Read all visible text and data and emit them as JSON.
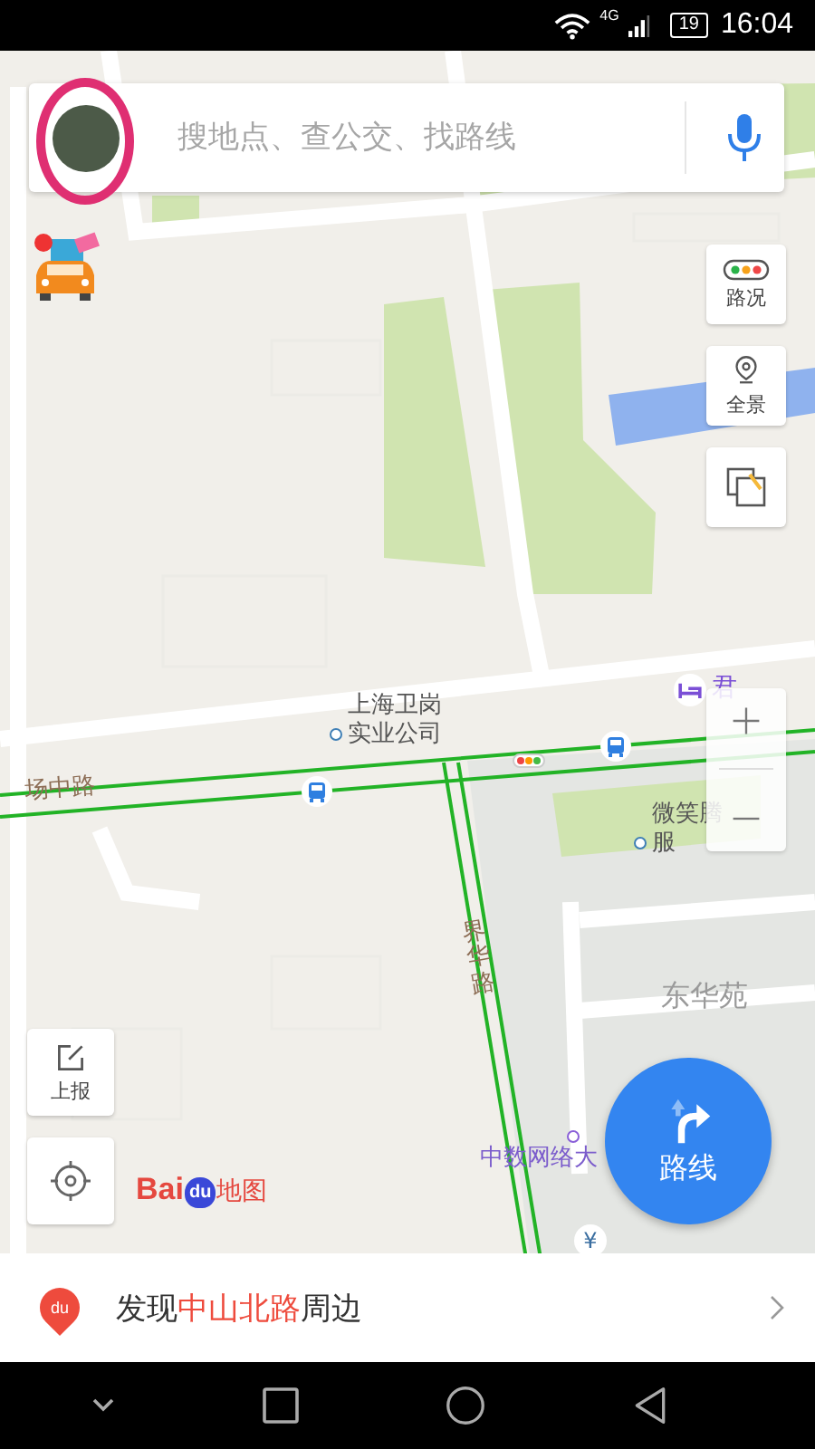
{
  "status_bar": {
    "network": "4G",
    "battery": "19",
    "time": "16:04"
  },
  "search": {
    "placeholder": "搜地点、查公交、找路线"
  },
  "map_controls": [
    {
      "kind": "traffic",
      "label": "路况"
    },
    {
      "kind": "panorama",
      "label": "全景"
    },
    {
      "kind": "layers"
    }
  ],
  "map_labels": [
    {
      "kind": "poi",
      "lines": [
        "上海卫岗",
        "实业公司"
      ]
    },
    {
      "kind": "road",
      "lines": [
        "场中路"
      ]
    },
    {
      "kind": "road_vertical",
      "lines": [
        "界华路"
      ]
    },
    {
      "kind": "area",
      "lines": [
        "东华苑"
      ]
    },
    {
      "kind": "building",
      "lines": [
        "中数网络大"
      ]
    },
    {
      "kind": "hotel",
      "lines": [
        "君"
      ]
    },
    {
      "kind": "poi",
      "lines": [
        "微笑腾",
        "服"
      ]
    }
  ],
  "bank_marker": "¥",
  "report_button": {
    "label": "上报"
  },
  "logo": {
    "latin": "Bai",
    "paw": "du",
    "suffix": "地图"
  },
  "route_button": {
    "label": "路线"
  },
  "discover": {
    "badge": "du",
    "prefix": "发现",
    "place": "中山北路",
    "suffix": "周边"
  }
}
